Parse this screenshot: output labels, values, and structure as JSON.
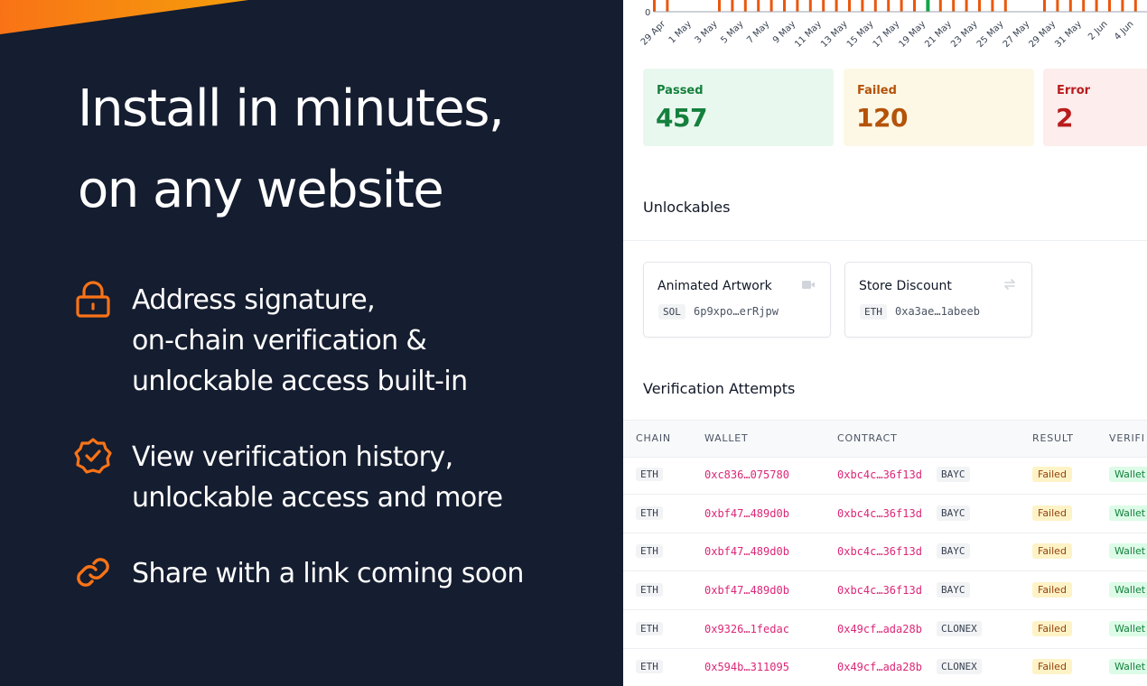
{
  "promo": {
    "headline_line1": "Install in minutes,",
    "headline_line2": "on any website",
    "features": [
      {
        "icon": "lock-icon",
        "lines": [
          "Address signature,",
          "on-chain verification &",
          "unlockable access built-in"
        ]
      },
      {
        "icon": "verified-badge-icon",
        "lines": [
          "View verification history,",
          "unlockable access and more"
        ]
      },
      {
        "icon": "link-icon",
        "lines": [
          "Share with a link coming soon"
        ]
      }
    ],
    "accent_color": "#f97316",
    "background_color": "#151d30"
  },
  "chart_data": {
    "type": "bar",
    "ylabel_zero": "0",
    "x_tick_labels": [
      "29 Apr",
      "1 May",
      "3 May",
      "5 May",
      "7 May",
      "9 May",
      "11 May",
      "13 May",
      "15 May",
      "17 May",
      "19 May",
      "21 May",
      "23 May",
      "25 May",
      "27 May",
      "29 May",
      "31 May",
      "2 Jun",
      "4 Jun"
    ],
    "series": [
      {
        "color": "#ea580c"
      },
      {
        "color": "#16a34a"
      }
    ]
  },
  "stats": {
    "passed": {
      "label": "Passed",
      "value": "457"
    },
    "failed": {
      "label": "Failed",
      "value": "120"
    },
    "error": {
      "label": "Error",
      "value": "2"
    }
  },
  "unlockables": {
    "title": "Unlockables",
    "items": [
      {
        "name": "Animated Artwork",
        "chain": "SOL",
        "address": "6p9xpo…erRjpw",
        "icon": "video-icon"
      },
      {
        "name": "Store Discount",
        "chain": "ETH",
        "address": "0xa3ae…1abeeb",
        "icon": "swap-arrows-icon"
      }
    ]
  },
  "attempts": {
    "title": "Verification Attempts",
    "columns": [
      "CHAIN",
      "WALLET",
      "CONTRACT",
      "RESULT",
      "VERIFI"
    ],
    "rows": [
      {
        "chain": "ETH",
        "wallet": "0xc836…075780",
        "contract": "0xbc4c…36f13d",
        "collection": "BAYC",
        "result": "Failed",
        "verification": "Wallet"
      },
      {
        "chain": "ETH",
        "wallet": "0xbf47…489d0b",
        "contract": "0xbc4c…36f13d",
        "collection": "BAYC",
        "result": "Failed",
        "verification": "Wallet"
      },
      {
        "chain": "ETH",
        "wallet": "0xbf47…489d0b",
        "contract": "0xbc4c…36f13d",
        "collection": "BAYC",
        "result": "Failed",
        "verification": "Wallet"
      },
      {
        "chain": "ETH",
        "wallet": "0xbf47…489d0b",
        "contract": "0xbc4c…36f13d",
        "collection": "BAYC",
        "result": "Failed",
        "verification": "Wallet"
      },
      {
        "chain": "ETH",
        "wallet": "0x9326…1fedac",
        "contract": "0x49cf…ada28b",
        "collection": "CLONEX",
        "result": "Failed",
        "verification": "Wallet"
      },
      {
        "chain": "ETH",
        "wallet": "0x594b…311095",
        "contract": "0x49cf…ada28b",
        "collection": "CLONEX",
        "result": "Failed",
        "verification": "Wallet"
      }
    ]
  }
}
